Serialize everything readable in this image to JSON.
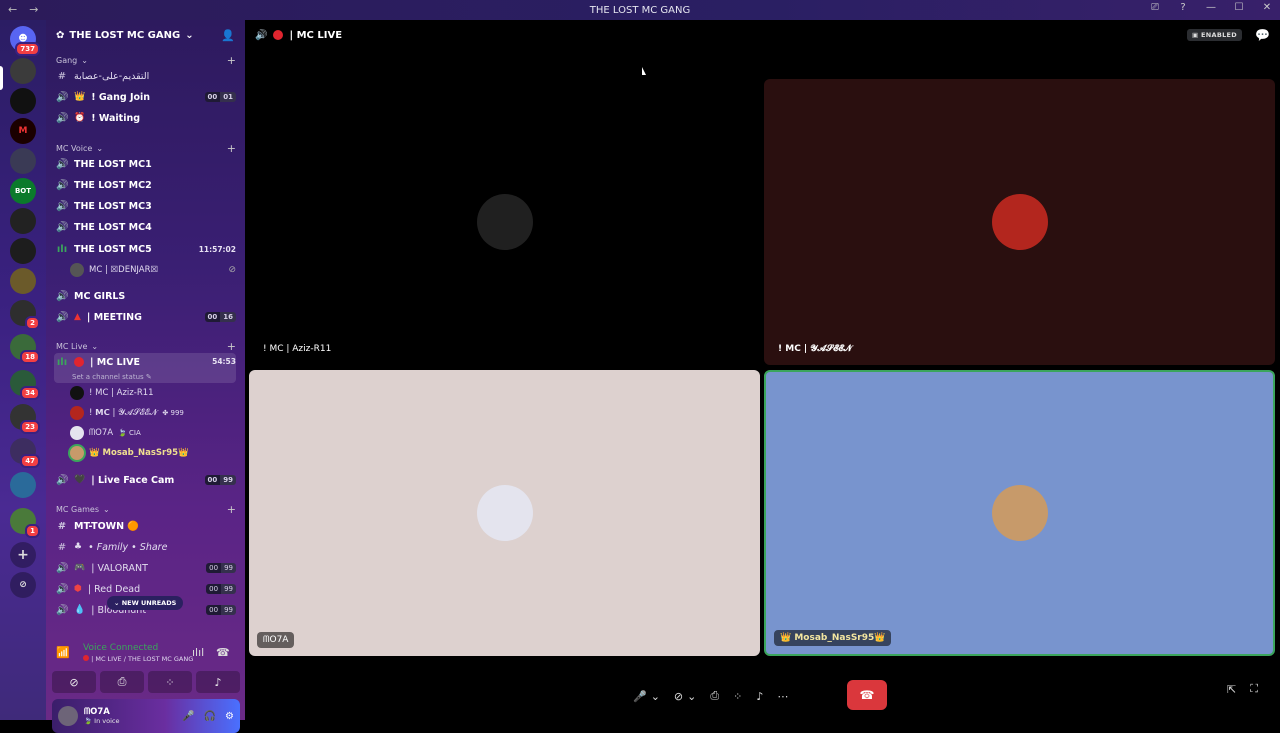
{
  "window": {
    "title": "THE LOST MC GANG",
    "nav_back": "←",
    "nav_forward": "→",
    "controls": [
      "⎚",
      "?",
      "—",
      "☐",
      "✕"
    ]
  },
  "servers": {
    "home_badge": "737",
    "badges": [
      "2",
      "18",
      "34",
      "23",
      "47",
      "1"
    ],
    "bot_label": "BOT"
  },
  "sidebar": {
    "guild_name": "THE LOST MC GANG",
    "categories": {
      "gang": "Gang",
      "mc_voice": "MC Voice",
      "mc_live": "MC Live",
      "mc_games": "MC Games"
    },
    "channels": {
      "rules": "التقديم-على-عصابة",
      "gang_join": "! Gang Join",
      "gang_join_counts": [
        "00",
        "01"
      ],
      "waiting": "! Waiting",
      "mc1": "THE LOST MC1",
      "mc2": "THE LOST MC2",
      "mc3": "THE LOST MC3",
      "mc4": "THE LOST MC4",
      "mc5": "THE LOST MC5",
      "mc5_time": "11:57:02",
      "mc5_user": "MC | ☒DENJAR☒",
      "mc_girls": "MC GIRLS",
      "meeting": "| MEETING",
      "meeting_counts": [
        "00",
        "16"
      ],
      "mc_live": "| MC LIVE",
      "mc_live_time": "54:53",
      "mc_live_status": "Set a channel status ✎",
      "live_face_cam": "| Live Face Cam",
      "live_face_cam_counts": [
        "00",
        "99"
      ],
      "mt_town": "MT-TOWN 🟠",
      "family_share": "• Family • Share",
      "valorant": "| VALORANT",
      "valorant_counts": [
        "00",
        "99"
      ],
      "red_dead": "| Red Dead",
      "red_dead_counts": [
        "00",
        "99"
      ],
      "bloodhunt": "| Bloodhunt",
      "bloodhunt_counts": [
        "00",
        "99"
      ]
    },
    "live_users": [
      {
        "name": "! MC | Aziz-R11",
        "tail": ""
      },
      {
        "name": "! 𝗠𝗖 | 𝓨𝓐𝓢𝓔𝓔𝓝",
        "tail": "✤ 999"
      },
      {
        "name": "ᗰO7A",
        "tail": "🍃 CIA"
      },
      {
        "name": "👑 Mosab_NasSr95👑",
        "tail": ""
      }
    ],
    "new_unreads": "⌄ NEW UNREADS"
  },
  "voice": {
    "title": "Voice Connected",
    "subtitle": "| MC LIVE / THE LOST MC GANG"
  },
  "userbar": {
    "name": "ᗰO7A",
    "status": "🍃 In voice"
  },
  "main": {
    "channel_title": "| MC LIVE",
    "enabled_label": "ENABLED"
  },
  "tiles": [
    {
      "name": "! MC | Aziz-R11",
      "bg": "#000000",
      "avatar": "#202020"
    },
    {
      "name": "! 𝗠𝗖 | 𝓨𝓐𝓢𝓔𝓔𝓝",
      "bg": "#2a0f0f",
      "avatar": "#b3261e"
    },
    {
      "name": "ᗰO7A",
      "bg": "#ddd1cf",
      "avatar": "#e4e4ee"
    },
    {
      "name": "👑 Mosab_NasSr95👑",
      "bg": "#7894ce",
      "avatar": "#c79a6a"
    }
  ],
  "colors": {
    "hangup": "#da373c",
    "speaking_border": "#3ba55c",
    "accent": "#5865f2"
  }
}
